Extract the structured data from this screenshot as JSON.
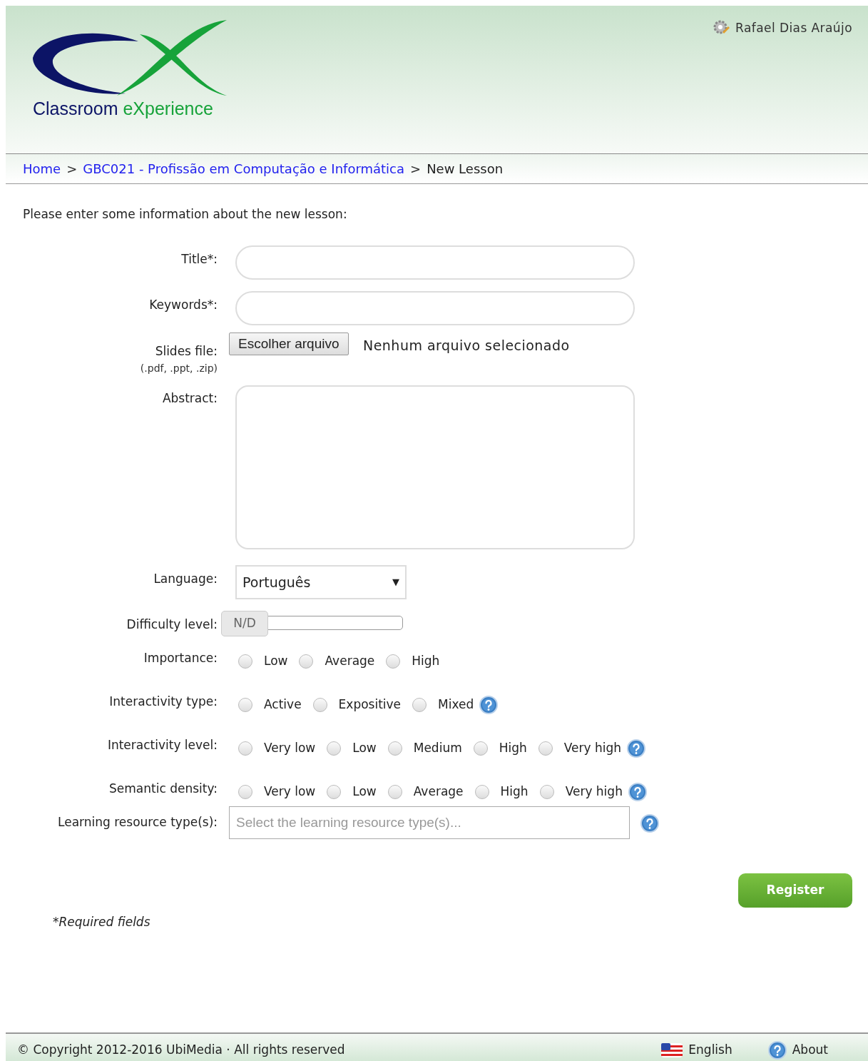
{
  "header": {
    "logo_text_dark": "Classroom",
    "logo_text_green": "eXperience",
    "user": "Rafael Dias Araújo"
  },
  "breadcrumb": [
    {
      "label": "Home",
      "link": true
    },
    {
      "label": "GBC021 - Profissão em Computação e Informática",
      "link": true
    },
    {
      "label": "New Lesson",
      "link": false
    }
  ],
  "breadcrumb_separator": ">",
  "intro": "Please enter some information about the new lesson:",
  "fields": {
    "title": {
      "label": "Title*:"
    },
    "keywords": {
      "label": "Keywords*:"
    },
    "slides": {
      "label": "Slides file:",
      "hint": "(.pdf, .ppt, .zip)",
      "button": "Escolher arquivo",
      "status": "Nenhum arquivo selecionado"
    },
    "abstract": {
      "label": "Abstract:"
    },
    "language": {
      "label": "Language:",
      "value": "Português",
      "caret": "▼"
    },
    "difficulty": {
      "label": "Difficulty level:",
      "handle": "N/D",
      "level": 0
    }
  },
  "radio_groups": [
    {
      "label": "Importance:",
      "help": false,
      "options": [
        {
          "label": "Low",
          "selected": false
        },
        {
          "label": "Average",
          "selected": false
        },
        {
          "label": "High",
          "selected": false
        }
      ]
    },
    {
      "label": "Interactivity type:",
      "help": true,
      "options": [
        {
          "label": "Active",
          "selected": false
        },
        {
          "label": "Expositive",
          "selected": false
        },
        {
          "label": "Mixed",
          "selected": false
        }
      ]
    },
    {
      "label": "Interactivity level:",
      "help": true,
      "options": [
        {
          "label": "Very low",
          "selected": false
        },
        {
          "label": "Low",
          "selected": false
        },
        {
          "label": "Medium",
          "selected": false
        },
        {
          "label": "High",
          "selected": false
        },
        {
          "label": "Very high",
          "selected": false
        }
      ]
    },
    {
      "label": "Semantic density:",
      "help": true,
      "options": [
        {
          "label": "Very low",
          "selected": false
        },
        {
          "label": "Low",
          "selected": false
        },
        {
          "label": "Average",
          "selected": false
        },
        {
          "label": "High",
          "selected": false
        },
        {
          "label": "Very high",
          "selected": false
        }
      ]
    }
  ],
  "resource_types": {
    "label": "Learning resource type(s):",
    "placeholder": "Select the learning resource type(s)..."
  },
  "register_button": "Register",
  "required_note": "*Required fields",
  "footer": {
    "copyright": "© Copyright 2012-2016 UbiMedia · All rights reserved",
    "language": "English",
    "about": "About"
  }
}
